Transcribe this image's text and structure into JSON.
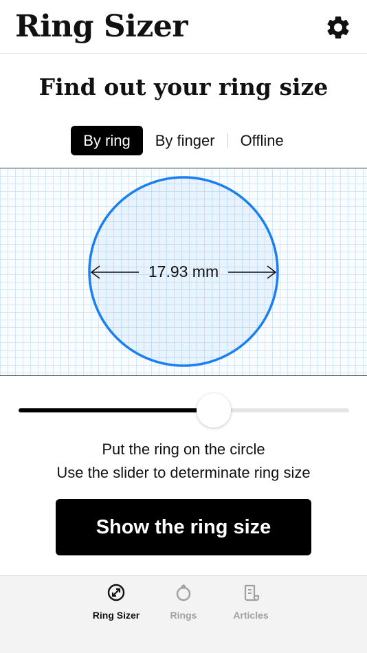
{
  "header": {
    "title": "Ring Sizer",
    "settings_icon": "gear-icon"
  },
  "page_title": "Find out your ring size",
  "tabs": [
    {
      "label": "By ring",
      "active": true
    },
    {
      "label": "By finger",
      "active": false
    },
    {
      "label": "Offline",
      "active": false
    }
  ],
  "measure": {
    "diameter_label": "17.93 mm",
    "circle_color": "#1a7ff0"
  },
  "slider": {
    "fraction": 0.6
  },
  "instructions": {
    "line1": "Put the ring on the circle",
    "line2": "Use the slider to determinate ring size"
  },
  "cta_label": "Show the ring size",
  "tabbar": [
    {
      "label": "Ring Sizer",
      "icon": "ruler-circle-icon",
      "active": true
    },
    {
      "label": "Rings",
      "icon": "ring-icon",
      "active": false
    },
    {
      "label": "Articles",
      "icon": "document-icon",
      "active": false
    }
  ]
}
